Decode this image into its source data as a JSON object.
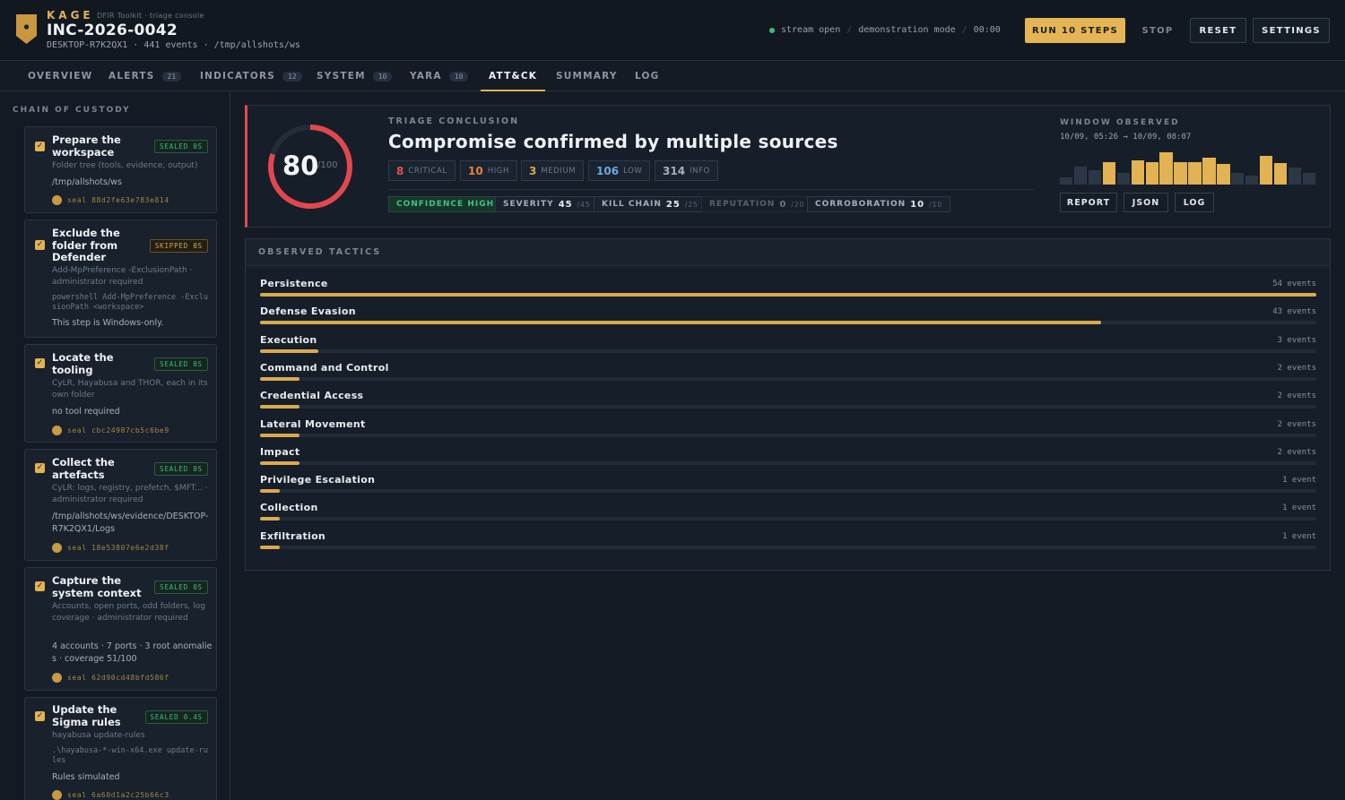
{
  "header": {
    "brand": "KAGE",
    "brand_sub": "DFIR Toolkit · triage console",
    "incident_id": "INC-2026-0042",
    "host": "DESKTOP-R7K2QX1",
    "events": "441 events",
    "path": "/tmp/allshots/ws",
    "stream": "stream open",
    "mode": "demonstration mode",
    "timer": "00:00",
    "buttons": {
      "run": "RUN 10 STEPS",
      "stop": "STOP",
      "reset": "RESET",
      "settings": "SETTINGS"
    }
  },
  "tabs": [
    {
      "label": "OVERVIEW",
      "count": ""
    },
    {
      "label": "ALERTS",
      "count": "21"
    },
    {
      "label": "INDICATORS",
      "count": "12"
    },
    {
      "label": "SYSTEM",
      "count": "10"
    },
    {
      "label": "YARA",
      "count": "10"
    },
    {
      "label": "ATT&CK",
      "count": "",
      "active": true
    },
    {
      "label": "SUMMARY",
      "count": ""
    },
    {
      "label": "LOG",
      "count": ""
    }
  ],
  "sidebar": {
    "title": "CHAIN OF CUSTODY",
    "steps": [
      {
        "title": "Prepare the workspace",
        "status": "SEALED 0S",
        "desc": "Folder tree (tools, evidence, output)",
        "output": "/tmp/allshots/ws",
        "seal": "seal 88d2fe63e783e814"
      },
      {
        "title": "Exclude the folder from Defender",
        "status": "SKIPPED 0S",
        "desc": "Add-MpPreference -ExclusionPath · administrator required",
        "cmd": "powershell Add-MpPreference -ExclusionPath <workspace>",
        "output": "This step is Windows-only."
      },
      {
        "title": "Locate the tooling",
        "status": "SEALED 0S",
        "desc": "CyLR, Hayabusa and THOR, each in its own folder",
        "output": "no tool required",
        "seal": "seal cbc24987cb5c6be9"
      },
      {
        "title": "Collect the artefacts",
        "status": "SEALED 0S",
        "desc": "CyLR: logs, registry, prefetch, $MFT... · administrator required",
        "output": "/tmp/allshots/ws/evidence/DESKTOP-R7K2QX1/Logs",
        "seal": "seal 18e53807e6e2d38f"
      },
      {
        "title": "Capture the system context",
        "status": "SEALED 0S",
        "desc": "Accounts, open ports, odd folders, log coverage · administrator required",
        "output": "4 accounts · 7 ports · 3 root anomalies · coverage 51/100",
        "seal": "seal 62d90cd48bfd586f"
      },
      {
        "title": "Update the Sigma rules",
        "status": "SEALED 0.4S",
        "desc": "hayabusa update-rules",
        "cmd": ".\\hayabusa-*-win-x64.exe update-rules",
        "output": "Rules simulated",
        "seal": "seal 6a60d1a2c25b66c3"
      }
    ]
  },
  "conclusion": {
    "score": "80",
    "score_max": "/100",
    "score_fraction": 0.8,
    "label": "TRIAGE CONCLUSION",
    "headline": "Compromise confirmed by multiple sources",
    "severities": [
      {
        "n": "8",
        "l": "CRITICAL",
        "color": "#e0524f"
      },
      {
        "n": "10",
        "l": "HIGH",
        "color": "#e8823a"
      },
      {
        "n": "3",
        "l": "MEDIUM",
        "color": "#d9a94a"
      },
      {
        "n": "106",
        "l": "LOW",
        "color": "#6aa9e0"
      },
      {
        "n": "314",
        "l": "INFO",
        "color": "#9aa6b3"
      }
    ],
    "confidence": "CONFIDENCE HIGH",
    "metrics": [
      {
        "label": "SEVERITY",
        "value": "45",
        "max": "/45"
      },
      {
        "label": "KILL CHAIN",
        "value": "25",
        "max": "/25"
      },
      {
        "label": "REPUTATION",
        "value": "0",
        "max": "/20",
        "dim": true
      },
      {
        "label": "CORROBORATION",
        "value": "10",
        "max": "/10"
      }
    ],
    "window_label": "WINDOW OBSERVED",
    "window_range": "10/09, 05:26 → 10/09, 08:07",
    "histogram": [
      0.18,
      0.47,
      0.37,
      0.6,
      0.3,
      0.65,
      0.6,
      0.85,
      0.6,
      0.6,
      0.72,
      0.55,
      0.3,
      0.25,
      0.77,
      0.58,
      0.45,
      0.3
    ],
    "histogram_hot": [
      false,
      false,
      false,
      true,
      false,
      true,
      true,
      true,
      true,
      true,
      true,
      true,
      false,
      false,
      true,
      true,
      false,
      false
    ],
    "actions": {
      "report": "REPORT",
      "json": "JSON",
      "log": "LOG"
    }
  },
  "tactics": {
    "title": "OBSERVED TACTICS",
    "max": 54,
    "items": [
      {
        "name": "Persistence",
        "count": 54,
        "label": "54 events"
      },
      {
        "name": "Defense Evasion",
        "count": 43,
        "label": "43 events"
      },
      {
        "name": "Execution",
        "count": 3,
        "label": "3 events"
      },
      {
        "name": "Command and Control",
        "count": 2,
        "label": "2 events"
      },
      {
        "name": "Credential Access",
        "count": 2,
        "label": "2 events"
      },
      {
        "name": "Lateral Movement",
        "count": 2,
        "label": "2 events"
      },
      {
        "name": "Impact",
        "count": 2,
        "label": "2 events"
      },
      {
        "name": "Privilege Escalation",
        "count": 1,
        "label": "1 event"
      },
      {
        "name": "Collection",
        "count": 1,
        "label": "1 event"
      },
      {
        "name": "Exfiltration",
        "count": 1,
        "label": "1 event"
      }
    ]
  }
}
